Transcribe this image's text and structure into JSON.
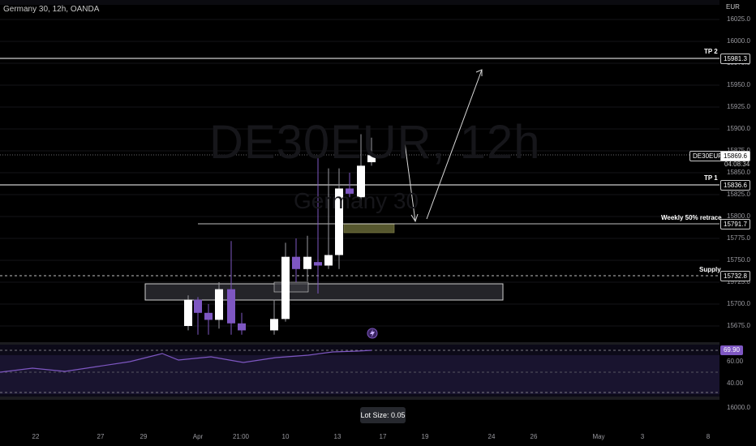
{
  "header": {
    "symbol_title": "Germany 30, 12h, OANDA",
    "currency": "EUR"
  },
  "watermark": {
    "ticker": "DE30EUR, 12h",
    "name": "Germany 30"
  },
  "price_axis": {
    "ticks": [
      "16025.0",
      "16000.0",
      "15975.0",
      "15950.0",
      "15925.0",
      "15900.0",
      "15875.0",
      "15850.0",
      "15825.0",
      "15800.0",
      "15775.0",
      "15750.0",
      "15725.0",
      "15700.0",
      "15675.0"
    ],
    "current_symbol": "DE30EUR",
    "current_price": "15869.6",
    "countdown": "04:08:34"
  },
  "levels": [
    {
      "label": "TP 2",
      "price": "15981.3",
      "style": "solid"
    },
    {
      "label": "TP 1",
      "price": "15836.6",
      "style": "solid"
    },
    {
      "label": "Weekly 50% retrace",
      "price": "15791.7",
      "style": "solid"
    },
    {
      "label": "Supply",
      "price": "15732.8",
      "style": "dashed"
    }
  ],
  "rsi": {
    "value": "69.90",
    "ticks": [
      "60.00",
      "40.00"
    ],
    "line_color": "#7e57c2",
    "badge_color": "#7e57c2"
  },
  "bottom_axis_value": "16000.0",
  "time_axis": [
    "22",
    "27",
    "29",
    "Apr",
    "21:00",
    "10",
    "13",
    "17",
    "19",
    "24",
    "26",
    "May",
    "3",
    "8"
  ],
  "lot_size": "Lot Size: 0.05",
  "colors": {
    "bull": "#ffffff",
    "bear": "#7e57c2",
    "fvg": "#56572e"
  },
  "chart_data": {
    "type": "candlestick",
    "price_unit": "EUR",
    "ylim": [
      15665,
      16035
    ],
    "candles": [
      {
        "o": 15675,
        "h": 15710,
        "l": 15670,
        "c": 15705
      },
      {
        "o": 15705,
        "h": 15708,
        "l": 15665,
        "c": 15690
      },
      {
        "o": 15690,
        "h": 15700,
        "l": 15665,
        "c": 15682
      },
      {
        "o": 15682,
        "h": 15725,
        "l": 15672,
        "c": 15717
      },
      {
        "o": 15717,
        "h": 15772,
        "l": 15665,
        "c": 15678
      },
      {
        "o": 15678,
        "h": 15690,
        "l": 15665,
        "c": 15670
      },
      {
        "o": 15670,
        "h": 15705,
        "l": 15665,
        "c": 15683
      },
      {
        "o": 15683,
        "h": 15770,
        "l": 15680,
        "c": 15754
      },
      {
        "o": 15754,
        "h": 15775,
        "l": 15725,
        "c": 15740
      },
      {
        "o": 15740,
        "h": 15778,
        "l": 15726,
        "c": 15754
      },
      {
        "o": 15748,
        "h": 15870,
        "l": 15712,
        "c": 15744
      },
      {
        "o": 15744,
        "h": 15855,
        "l": 15740,
        "c": 15756
      },
      {
        "o": 15756,
        "h": 15855,
        "l": 15740,
        "c": 15832
      },
      {
        "o": 15832,
        "h": 15850,
        "l": 15822,
        "c": 15826
      },
      {
        "o": 15822,
        "h": 15894,
        "l": 15812,
        "c": 15858
      },
      {
        "o": 15862,
        "h": 15890,
        "l": 15858,
        "c": 15870
      }
    ]
  }
}
